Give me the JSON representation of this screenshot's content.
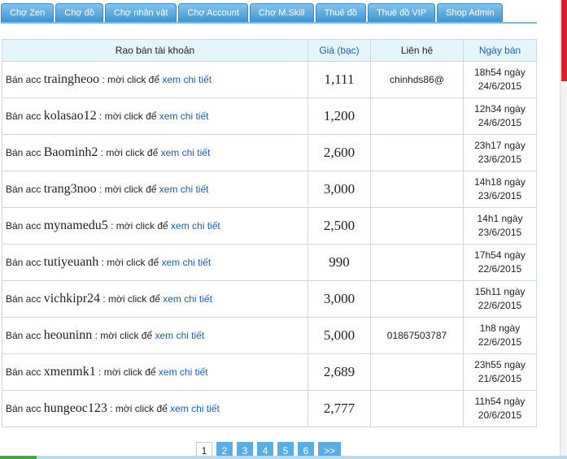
{
  "tabs": [
    {
      "label": "Chợ Zen"
    },
    {
      "label": "Chợ đồ"
    },
    {
      "label": "Chợ nhân vật"
    },
    {
      "label": "Chợ Account"
    },
    {
      "label": "Chợ M.Skill"
    },
    {
      "label": "Thuê đồ"
    },
    {
      "label": "Thuê đồ VIP"
    },
    {
      "label": "Shop Admin"
    }
  ],
  "table": {
    "headers": {
      "desc": "Rao bán tài khoản",
      "price": "Giá (bạc)",
      "contact": "Liên hệ",
      "date": "Ngày bán"
    },
    "rows": [
      {
        "prefix": "Bán acc ",
        "account": "traingheoo",
        "middle": " : mời click để ",
        "link": "xem chi tiết",
        "price": "1,111",
        "contact": "chinhds86@",
        "time": "18h54 ngày",
        "date": "24/6/2015"
      },
      {
        "prefix": "Bán acc ",
        "account": "kolasao12",
        "middle": " : mời click để ",
        "link": "xem chi tiết",
        "price": "1,200",
        "contact": "",
        "time": "12h34 ngày",
        "date": "24/6/2015"
      },
      {
        "prefix": "Bán acc ",
        "account": "Baominh2",
        "middle": " : mời click để ",
        "link": "xem chi tiết",
        "price": "2,600",
        "contact": "",
        "time": "23h17 ngày",
        "date": "23/6/2015"
      },
      {
        "prefix": "Bán acc ",
        "account": "trang3noo",
        "middle": " : mời click để ",
        "link": "xem chi tiết",
        "price": "3,000",
        "contact": "",
        "time": "14h18 ngày",
        "date": "23/6/2015"
      },
      {
        "prefix": "Bán acc ",
        "account": "mynamedu5",
        "middle": " : mời click để ",
        "link": "xem chi tiết",
        "price": "2,500",
        "contact": "",
        "time": "14h1 ngày",
        "date": "23/6/2015"
      },
      {
        "prefix": "Bán acc ",
        "account": "tutiyeuanh",
        "middle": " : mời click để ",
        "link": "xem chi tiết",
        "price": "990",
        "contact": "",
        "time": "17h54 ngày",
        "date": "22/6/2015"
      },
      {
        "prefix": "Bán acc ",
        "account": "vichkipr24",
        "middle": " : mời click để ",
        "link": "xem chi tiết",
        "price": "3,000",
        "contact": "",
        "time": "15h11 ngày",
        "date": "22/6/2015"
      },
      {
        "prefix": "Bán acc ",
        "account": "heouninn",
        "middle": " : mời click để ",
        "link": "xem chi tiết",
        "price": "5,000",
        "contact": "01867503787",
        "time": "1h8 ngày",
        "date": "22/6/2015"
      },
      {
        "prefix": "Bán acc ",
        "account": "xmenmk1",
        "middle": " : mời click để ",
        "link": "xem chi tiết",
        "price": "2,689",
        "contact": "",
        "time": "23h55 ngày",
        "date": "21/6/2015"
      },
      {
        "prefix": "Bán acc ",
        "account": "hungeoc123",
        "middle": " : mời click để ",
        "link": "xem chi tiết",
        "price": "2,777",
        "contact": "",
        "time": "11h54 ngày",
        "date": "20/6/2015"
      }
    ]
  },
  "pagination": {
    "current": "1",
    "pages": [
      "2",
      "3",
      "4",
      "5",
      "6"
    ],
    "next": ">>"
  },
  "colors": {
    "tab": "#3a93d2",
    "header_bg": "#e4f4fb",
    "link": "#1a5fb4",
    "page_button": "#5aaee4",
    "scroll_thumb": "#d5222a"
  }
}
